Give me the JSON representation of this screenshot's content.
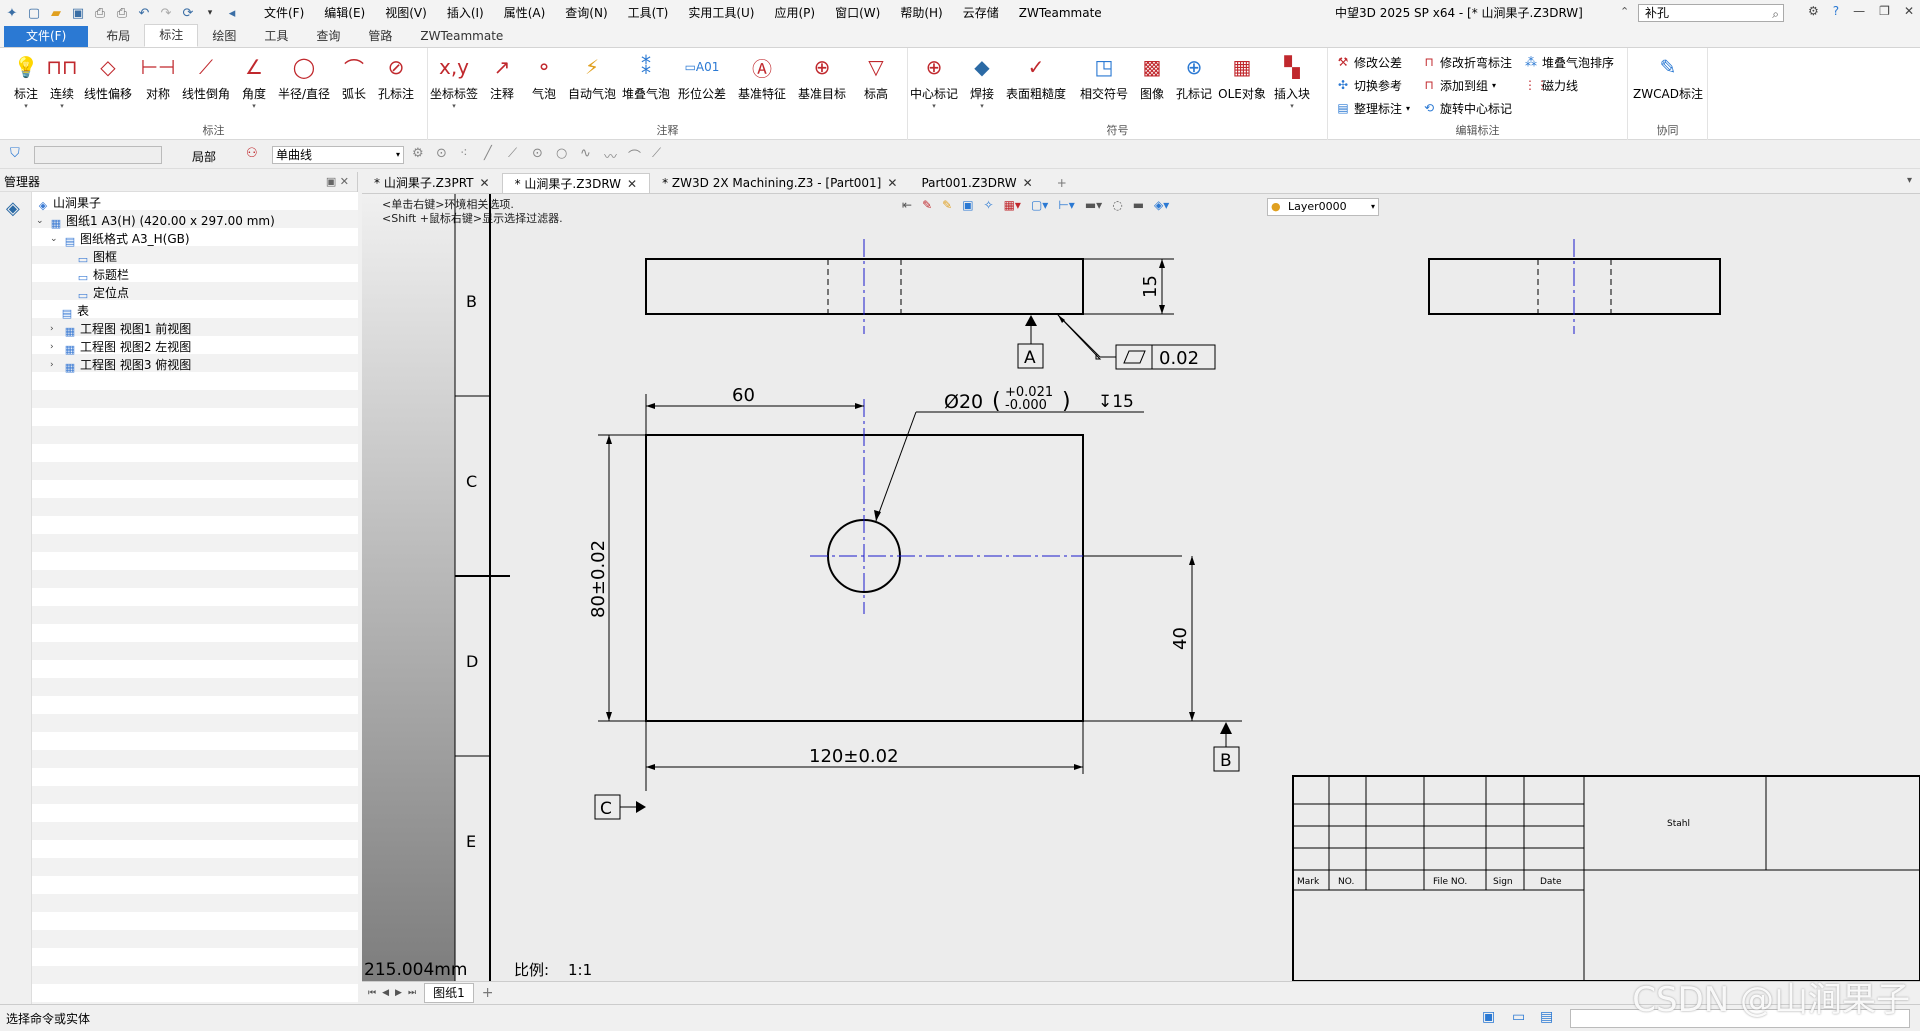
{
  "title_bar": {
    "menus": [
      "文件(F)",
      "编辑(E)",
      "视图(V)",
      "插入(I)",
      "属性(A)",
      "查询(N)",
      "工具(T)",
      "实用工具(U)",
      "应用(P)",
      "窗口(W)",
      "帮助(H)",
      "云存储",
      "ZWTeammate"
    ],
    "window_title": "中望3D 2025 SP x64 - [* 山涧果子.Z3DRW]",
    "search_value": "补孔"
  },
  "ribbon_tabs": [
    "文件(F)",
    "布局",
    "标注",
    "绘图",
    "工具",
    "查询",
    "管路",
    "ZWTeammate"
  ],
  "ribbon_active_tab": "标注",
  "ribbon_groups": {
    "dim": {
      "label": "标注",
      "buttons": [
        "标注",
        "连续",
        "线性偏移",
        "对称",
        "线性倒角",
        "角度",
        "半径/直径",
        "弧长",
        "孔标注"
      ]
    },
    "anno": {
      "label": "注释",
      "buttons": [
        "坐标标签",
        "注释",
        "气泡",
        "自动气泡",
        "堆叠气泡",
        "形位公差",
        "基准特征",
        "基准目标",
        "标高"
      ]
    },
    "sym": {
      "label": "符号",
      "buttons": [
        "中心标记",
        "焊接",
        "表面粗糙度",
        "相交符号",
        "图像",
        "孔标记",
        "OLE对象",
        "插入块"
      ]
    },
    "edit": {
      "label": "编辑标注",
      "buttons": [
        "修改公差",
        "修改折弯标注",
        "堆叠气泡排序",
        "切换参考",
        "添加到组",
        "磁力线",
        "整理标注",
        "旋转中心标记"
      ]
    },
    "collab": {
      "label": "协同",
      "buttons": [
        "ZWCAD标注"
      ]
    }
  },
  "toolbar2": {
    "scope": "局部",
    "curve_type": "单曲线"
  },
  "doc_tabs": [
    {
      "label": "* 山涧果子.Z3PRT",
      "active": false
    },
    {
      "label": "* 山涧果子.Z3DRW",
      "active": true
    },
    {
      "label": "* ZW3D 2X Machining.Z3 - [Part001]",
      "active": false
    },
    {
      "label": "Part001.Z3DRW",
      "active": false
    }
  ],
  "manager": {
    "title": "管理器",
    "tree": [
      "山涧果子",
      "图纸1 A3(H) (420.00 x 297.00 mm)",
      "图纸格式 A3_H(GB)",
      "图框",
      "标题栏",
      "定位点",
      "表",
      "工程图 视图1 前视图",
      "工程图 视图2 左视图",
      "工程图 视图3 俯视图"
    ]
  },
  "canvas": {
    "hints": [
      "<单击右键>环境相关选项.",
      "<Shift +鼠标右键>显示选择过滤器."
    ],
    "layer": "Layer0000",
    "zone_letters": [
      "B",
      "C",
      "D",
      "E"
    ],
    "readout": "215.004mm",
    "scale_label": "比例:",
    "scale_value": "1:1"
  },
  "drawing": {
    "dim_15": "15",
    "datum_a": "A",
    "flatness_value": "0.02",
    "dim_60": "60",
    "hole_callout": "Ø20",
    "hole_tol_upper": "+0.021",
    "hole_tol_lower": "-0.000",
    "hole_depth": "↧15",
    "dim_80": "80±0.02",
    "dim_40": "40",
    "dim_120": "120±0.02",
    "datum_b": "B",
    "datum_c": "C",
    "title_block": {
      "material": "Stahl",
      "headers": [
        "Mark",
        "NO.",
        "File NO.",
        "Sign",
        "Date"
      ]
    }
  },
  "sheet_tabs": [
    "图纸1"
  ],
  "status": "选择命令或实体",
  "watermark": "CSDN @山涧果子",
  "colors": {
    "accent": "#2b79d3",
    "centerline": "#1a1acc",
    "drawing": "#000000"
  }
}
